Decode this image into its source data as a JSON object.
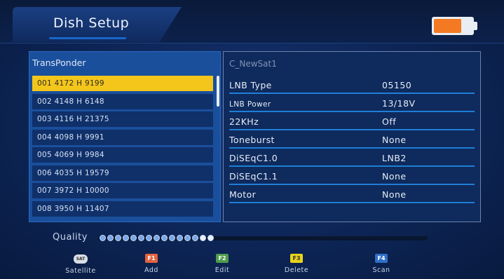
{
  "header": {
    "title": "Dish Setup",
    "battery_level": 0.72,
    "battery_color": "#f37a22"
  },
  "transponder": {
    "heading": "TransPonder",
    "selected_index": 0,
    "items": [
      "001 4172 H 9199",
      "002 4148 H 6148",
      "003 4116 H 21375",
      "004 4098 H 9991",
      "005 4069 H 9984",
      "006 4035 H 19579",
      "007 3972 H 10000",
      "008 3950 H 11407"
    ]
  },
  "settings": {
    "satellite_name": "C_NewSat1",
    "rows": [
      {
        "label": "LNB Type",
        "value": "05150"
      },
      {
        "label": "LNB Power",
        "value": "13/18V"
      },
      {
        "label": "22KHz",
        "value": "Off"
      },
      {
        "label": "Toneburst",
        "value": "None"
      },
      {
        "label": "DiSEqC1.0",
        "value": "LNB2"
      },
      {
        "label": "DiSEqC1.1",
        "value": "None"
      },
      {
        "label": "Motor",
        "value": "None"
      }
    ]
  },
  "quality": {
    "label": "Quality",
    "level": 0.34
  },
  "footer": {
    "items": [
      {
        "key": "SAT",
        "label": "Satellite",
        "color": "#d9dee6"
      },
      {
        "key": "F1",
        "label": "Add",
        "color": "#e2623f"
      },
      {
        "key": "F2",
        "label": "Edit",
        "color": "#4e9b4c"
      },
      {
        "key": "F3",
        "label": "Delete",
        "color": "#e8d419"
      },
      {
        "key": "F4",
        "label": "Scan",
        "color": "#2d6fc6"
      }
    ]
  }
}
